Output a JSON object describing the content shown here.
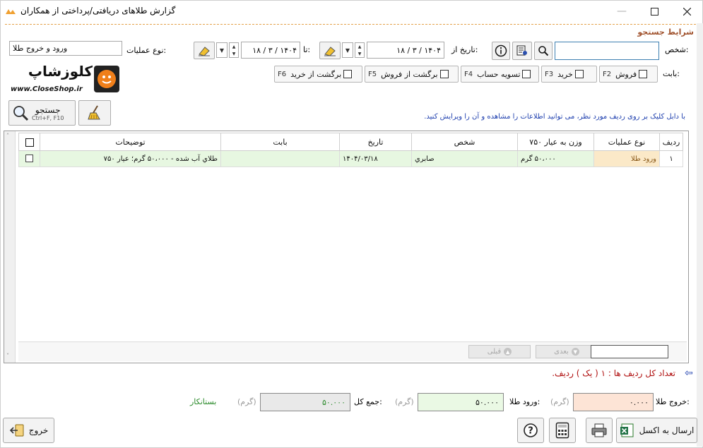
{
  "window": {
    "title": "گزارش طلاهای دریافتی/پرداختی از همکاران",
    "minimize_icon": "minimize-icon",
    "maximize_icon": "maximize-icon",
    "close_icon": "close-icon"
  },
  "search_section": {
    "title": "شرایط جستجو",
    "person_label": "شخص:",
    "person_value": "",
    "date_from_label": "تاریخ از:",
    "date_from_value": "۱۸ / ۳ / ۱۴۰۴",
    "date_to_label": "تا:",
    "date_to_value": "۱۸ / ۳ / ۱۴۰۴",
    "operation_type_label": "نوع عملیات:",
    "operation_type_value": "ورود و خروج طلا",
    "category_label": "بابت:",
    "categories": [
      {
        "label": "فروش",
        "key": "F2"
      },
      {
        "label": "خرید",
        "key": "F3"
      },
      {
        "label": "تسویه حساب",
        "key": "F4"
      },
      {
        "label": "برگشت از فروش",
        "key": "F5"
      },
      {
        "label": "برگشت از خرید",
        "key": "F6"
      }
    ],
    "search_button_label": "جستجو",
    "search_button_shortcut": "Ctrl+F, F10",
    "hint": "با دابل کلیک بر روی ردیف مورد نظر، می توانید اطلاعات را مشاهده و آن را ویرایش کنید."
  },
  "logo": {
    "text": "کلوزشاپ",
    "url": "www.CloseShop.ir"
  },
  "table": {
    "columns": [
      "ردیف",
      "نوع عملیات",
      "وزن به عیار ۷۵۰",
      "شخص",
      "تاریخ",
      "بابت",
      "توضیحات",
      ""
    ],
    "rows": [
      {
        "index": "۱",
        "operation": "ورود طلا",
        "weight": "۵۰،۰۰۰ گرم",
        "person": "صابري",
        "date": "۱۴۰۴/۰۳/۱۸",
        "category": "",
        "description": "طلاي آب شده - ۵۰،۰۰۰ گرم؛ عيار ۷۵۰"
      }
    ],
    "pager": {
      "next_label": "بعدی",
      "prev_label": "قبلی"
    }
  },
  "summary": {
    "row_count_text": "تعداد کل ردیف ها : ۱ ( یک ) ردیف.",
    "gold_out_label": "خروج طلا:",
    "gold_out_value": "۰.۰۰۰",
    "gold_in_label": "ورود طلا:",
    "gold_in_value": "۵۰.۰۰۰",
    "total_label": "جمع کل:",
    "total_value": "۵۰.۰۰۰",
    "unit": "(گرم)",
    "status": "بستانکار"
  },
  "footer": {
    "excel_button_label": "ارسال به اکسل",
    "exit_button_label": "خروج"
  },
  "colors": {
    "accent_orange": "#e3a24a",
    "section_title": "#a0522d",
    "row_bg": "#e7f7e1",
    "operation_cell_bg": "#fbe9c8",
    "gold_out_bg": "#fde4d6",
    "gold_in_bg": "#eaf9e4",
    "total_bg": "#e9e9e9",
    "status_green": "#2a8a2a",
    "count_red": "#b01010",
    "hint_blue": "#1e3fae"
  }
}
